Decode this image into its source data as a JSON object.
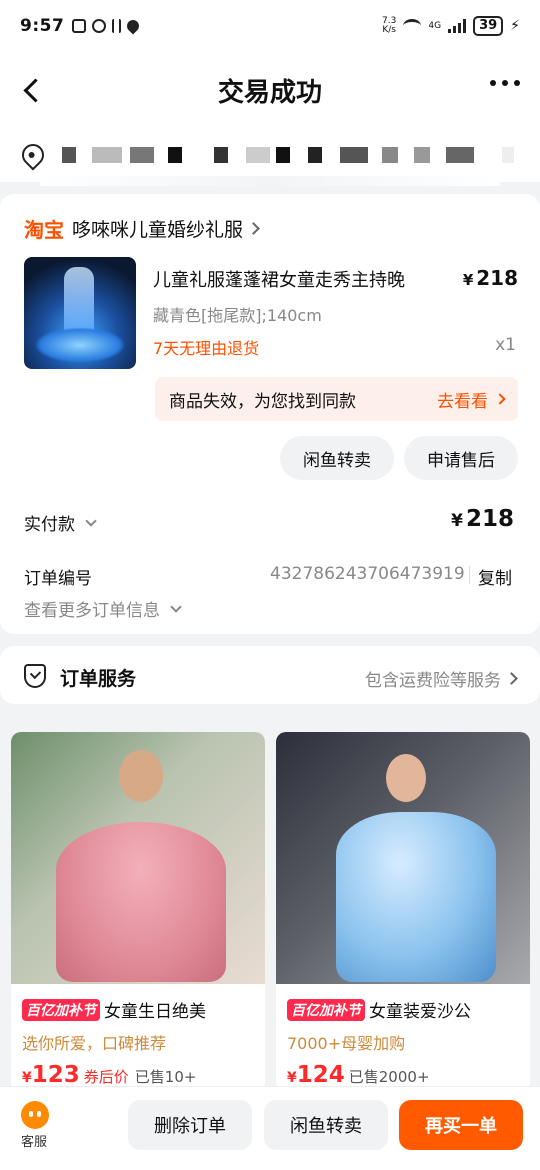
{
  "status_bar": {
    "time": "9:57",
    "net_speed_top": "7.3",
    "net_speed_bottom": "K/s",
    "network": "4G",
    "battery": "39"
  },
  "header": {
    "title": "交易成功"
  },
  "order": {
    "platform": "淘宝",
    "shop_name": "哆唻咪儿童婚纱礼服",
    "product_title": "儿童礼服蓬蓬裙女童走秀主持晚",
    "price_symbol": "¥",
    "price": "218",
    "spec": "藏青色[拖尾款];140cm",
    "return_policy": "7天无理由退货",
    "quantity": "x1",
    "invalid_notice": "商品失效，为您找到同款",
    "invalid_link": "去看看",
    "btn_resell": "闲鱼转卖",
    "btn_after_sale": "申请售后",
    "paid_label": "实付款",
    "paid_amount": "218",
    "order_no_label": "订单编号",
    "order_no": "432786243706473919",
    "copy_label": "复制",
    "more_info": "查看更多订单信息"
  },
  "service": {
    "title": "订单服务",
    "summary": "包含运费险等服务"
  },
  "recommendations": [
    {
      "promo": "百亿加补节",
      "title": "女童生日绝美",
      "subtitle": "选你所爱，口碑推荐",
      "price_symbol": "¥",
      "price": "123",
      "price_tag": "券后价",
      "sold": "已售10+"
    },
    {
      "promo": "百亿加补节",
      "title": "女童装爱沙公",
      "subtitle": "7000+母婴加购",
      "price_symbol": "¥",
      "price": "124",
      "price_tag": "",
      "sold": "已售2000+"
    }
  ],
  "bottom_bar": {
    "customer_service": "客服",
    "delete_order": "删除订单",
    "resell": "闲鱼转卖",
    "buy_again": "再买一单"
  },
  "colors": {
    "accent": "#ff5000",
    "promo_red": "#ff2a4d",
    "price_red": "#ff2a2a",
    "background": "#f2f3f5"
  }
}
